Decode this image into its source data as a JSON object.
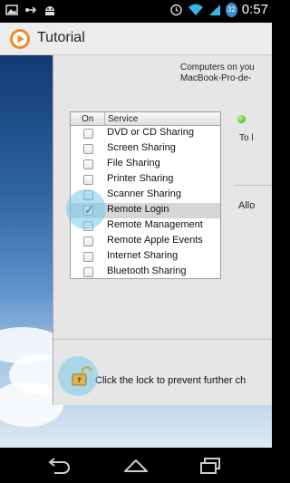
{
  "status_bar": {
    "time": "0:57",
    "battery_level": "32",
    "left_icons": [
      "gallery-icon",
      "usb-debug-icon",
      "android-icon"
    ],
    "right_icons": [
      "alarm-icon",
      "wifi-icon",
      "signal-icon",
      "battery-icon"
    ]
  },
  "app_bar": {
    "title": "Tutorial"
  },
  "mac_window": {
    "computers_line1": "Computers on you",
    "computers_line2": "MacBook-Pro-de-",
    "table": {
      "col_on": "On",
      "col_service": "Service",
      "rows": [
        {
          "label": "DVD or CD Sharing",
          "checked": false,
          "selected": false
        },
        {
          "label": "Screen Sharing",
          "checked": false,
          "selected": false
        },
        {
          "label": "File Sharing",
          "checked": false,
          "selected": false
        },
        {
          "label": "Printer Sharing",
          "checked": false,
          "selected": false
        },
        {
          "label": "Scanner Sharing",
          "checked": false,
          "selected": false
        },
        {
          "label": "Remote Login",
          "checked": true,
          "selected": true
        },
        {
          "label": "Remote Management",
          "checked": false,
          "selected": false
        },
        {
          "label": "Remote Apple Events",
          "checked": false,
          "selected": false
        },
        {
          "label": "Internet Sharing",
          "checked": false,
          "selected": false
        },
        {
          "label": "Bluetooth Sharing",
          "checked": false,
          "selected": false
        }
      ]
    },
    "right_panel": {
      "to_text": "To l",
      "allo_text": "Allo"
    },
    "lock_text": "Click the lock to prevent further ch"
  },
  "colors": {
    "highlight": "#78c8eb",
    "status_green": "#2fa11d",
    "selected_row": "#d6d6d6"
  }
}
